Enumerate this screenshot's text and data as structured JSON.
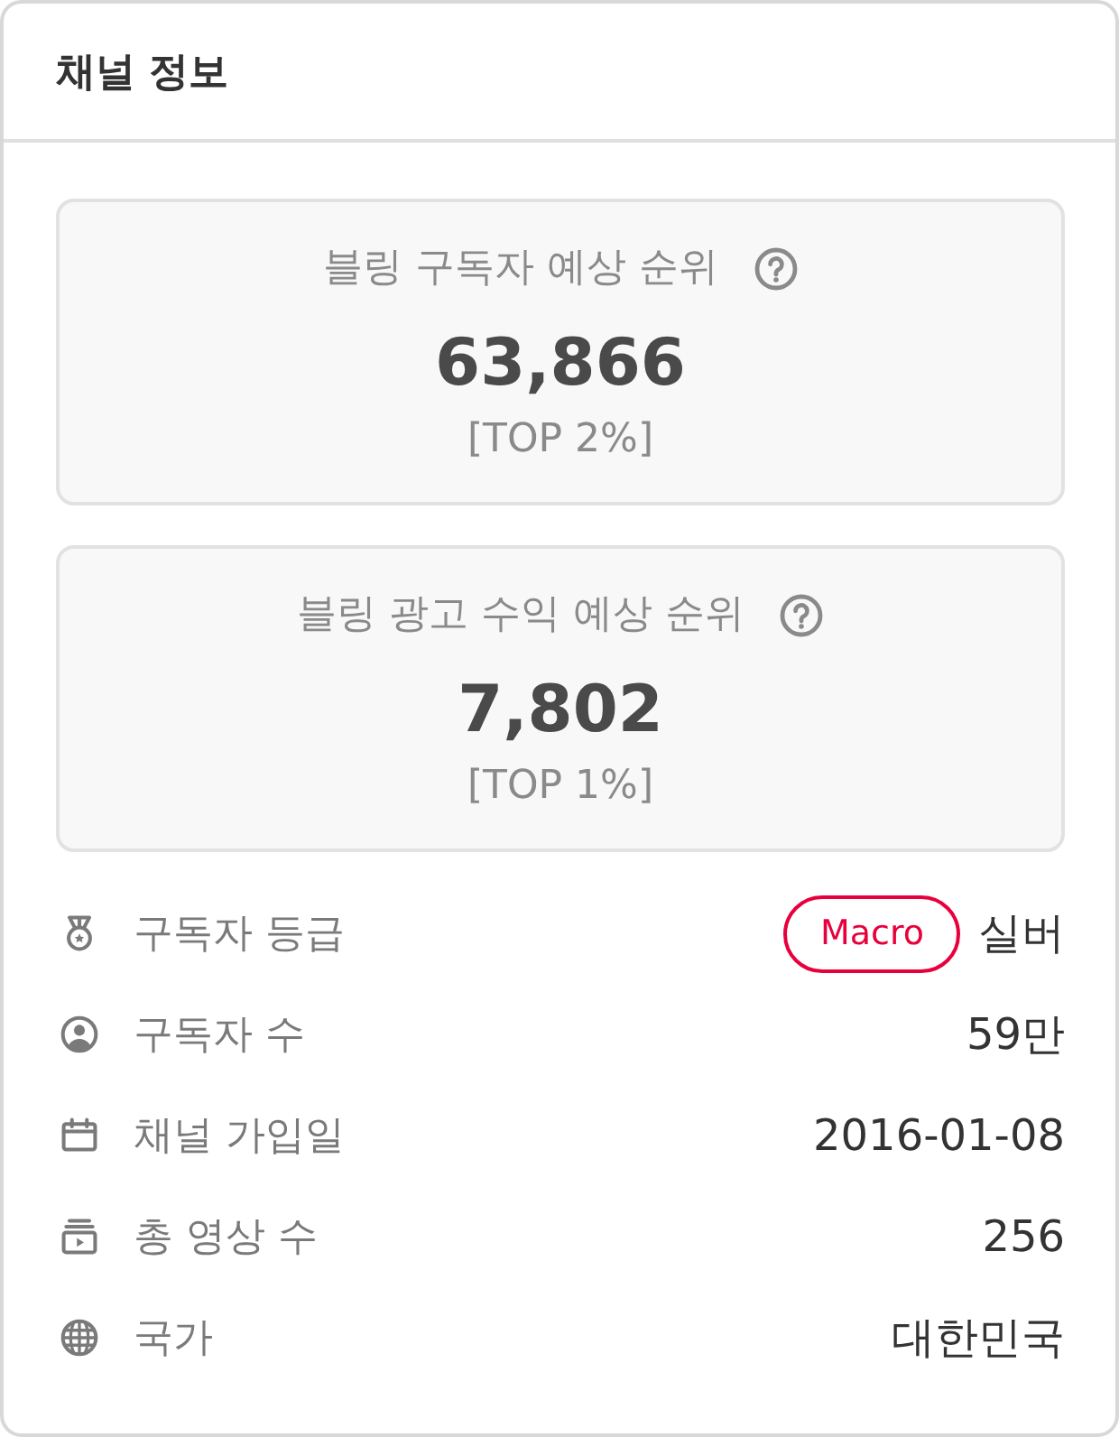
{
  "panel": {
    "title": "채널 정보"
  },
  "rankings": [
    {
      "label": "블링 구독자 예상 순위",
      "value": "63,866",
      "top": "[TOP 2%]"
    },
    {
      "label": "블링 광고 수익 예상 순위",
      "value": "7,802",
      "top": "[TOP 1%]"
    }
  ],
  "details": [
    {
      "label": "구독자 등급",
      "badge": "Macro",
      "value": "실버"
    },
    {
      "label": "구독자 수",
      "value": "59만"
    },
    {
      "label": "채널 가입일",
      "value": "2016-01-08"
    },
    {
      "label": "총 영상 수",
      "value": "256"
    },
    {
      "label": "국가",
      "value": "대한민국"
    }
  ]
}
